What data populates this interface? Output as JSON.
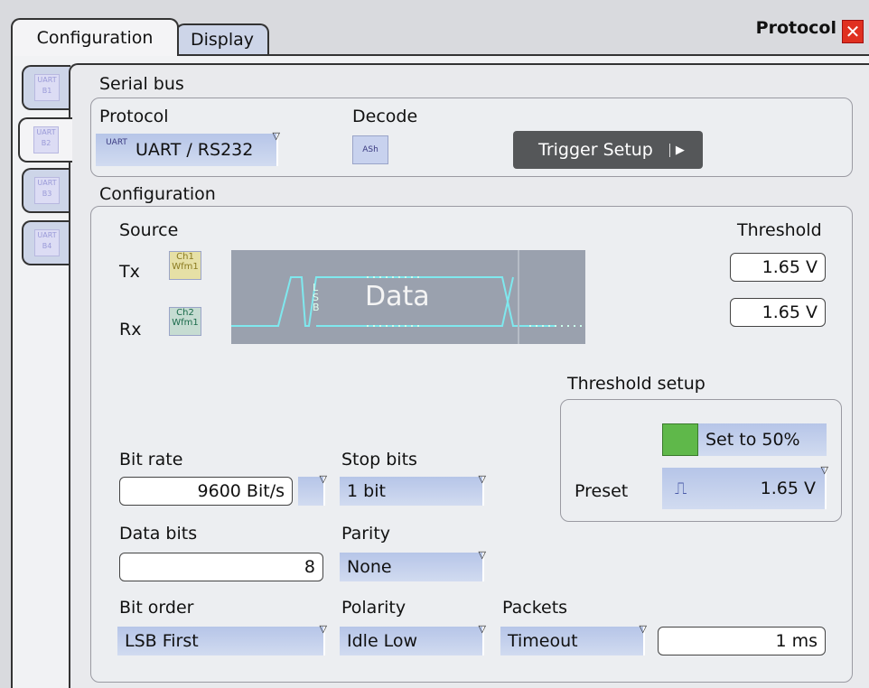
{
  "tabs": {
    "configuration": "Configuration",
    "display": "Display"
  },
  "panel_title": "Protocol",
  "side_tabs": [
    "UART B1",
    "UART B2",
    "UART B3",
    "UART B4"
  ],
  "serial_bus": {
    "heading": "Serial bus",
    "protocol_label": "Protocol",
    "protocol_value": "UART / RS232",
    "protocol_icon_text": "UART",
    "decode_label": "Decode",
    "decode_icon_text": "ASh",
    "trigger_setup": "Trigger Setup"
  },
  "configuration": {
    "heading": "Configuration",
    "source_label": "Source",
    "tx_label": "Tx",
    "rx_label": "Rx",
    "tx_icon_text": "Ch1 Wfm1",
    "rx_icon_text": "Ch2 Wfm1",
    "waveform_data_label": "Data",
    "waveform_lsb_label": "LSB",
    "threshold_label": "Threshold",
    "threshold_tx": "1.65 V",
    "threshold_rx": "1.65 V",
    "threshold_setup_label": "Threshold setup",
    "set_to_50": "Set to 50%",
    "preset_label": "Preset",
    "preset_value": "1.65 V",
    "bit_rate_label": "Bit rate",
    "bit_rate_value": "9600 Bit/s",
    "stop_bits_label": "Stop bits",
    "stop_bits_value": "1 bit",
    "data_bits_label": "Data bits",
    "data_bits_value": "8",
    "parity_label": "Parity",
    "parity_value": "None",
    "bit_order_label": "Bit order",
    "bit_order_value": "LSB First",
    "polarity_label": "Polarity",
    "polarity_value": "Idle Low",
    "packets_label": "Packets",
    "packets_value": "Timeout",
    "packets_timeout_value": "1 ms"
  }
}
